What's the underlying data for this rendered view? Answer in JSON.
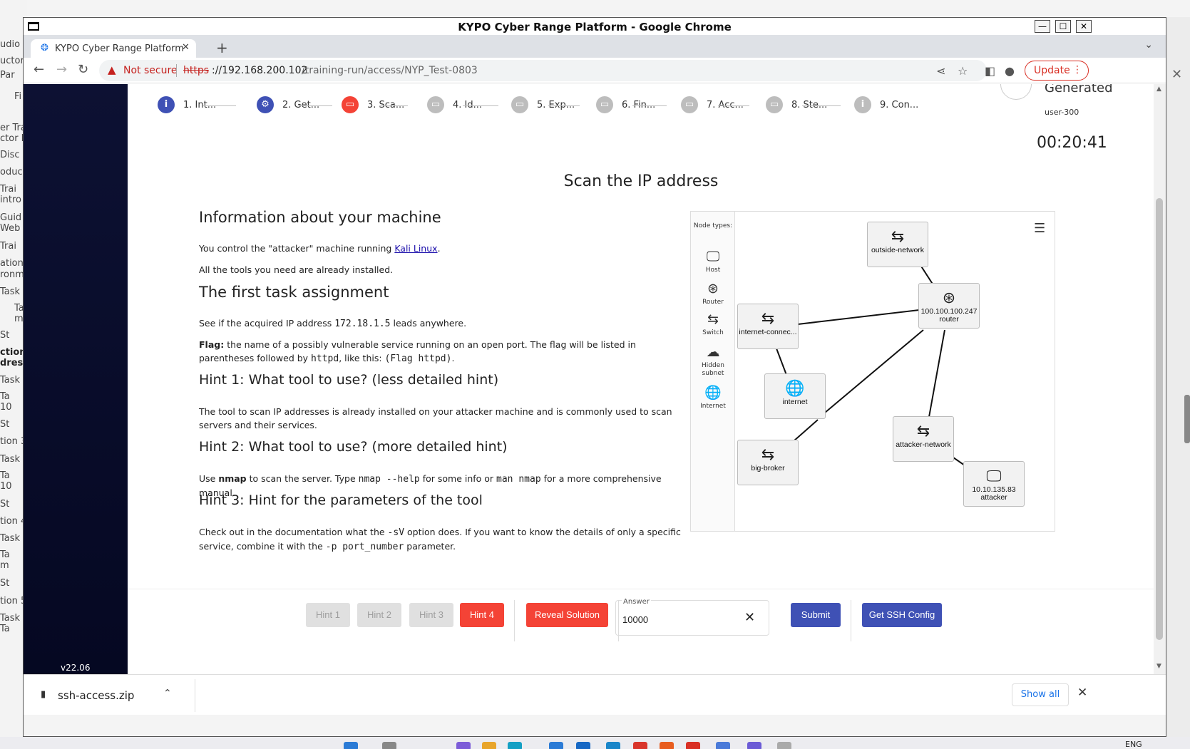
{
  "desktop": {
    "left_fragments": [
      "udio",
      "uctor_",
      "Par",
      "Fi",
      "er Trai",
      "ctor N",
      "Disc",
      "oduc",
      "Trai",
      "intro",
      "Guid",
      "Web",
      "Trai",
      "ation",
      "ronm",
      "Task",
      "Ta",
      "m",
      "St",
      "ction",
      "dress",
      "Task",
      "Ta",
      "10",
      "St",
      "tion 3",
      "Task",
      "Ta",
      "10",
      "St",
      "tion 4",
      "Task",
      "Ta",
      "m",
      "St",
      "tion 5",
      "Task",
      "Ta"
    ]
  },
  "window": {
    "title": "KYPO Cyber Range Platform - Google Chrome",
    "tab_title": "KYPO Cyber Range Platform",
    "tab_close": "✕",
    "new_tab": "+",
    "minimize": "—",
    "maximize": "☐",
    "close": "✕"
  },
  "toolbar": {
    "security": "Not secure",
    "url_scheme": "https",
    "url_host": "://192.168.200.102",
    "url_path": "/training-run/access/NYP_Test-0803",
    "update_label": "Update"
  },
  "sidebar": {
    "version": "v22.06"
  },
  "stepper": {
    "steps": [
      {
        "label": "1. Int...",
        "icon": "info-icon",
        "color": "#3f51b5"
      },
      {
        "label": "2. Get...",
        "icon": "gear-icon",
        "color": "#3f51b5"
      },
      {
        "label": "3. Sca...",
        "icon": "gamepad-icon",
        "color": "#f44336"
      },
      {
        "label": "4. Id...",
        "icon": "gamepad-icon",
        "color": "#bdbdbd"
      },
      {
        "label": "5. Exp...",
        "icon": "gamepad-icon",
        "color": "#bdbdbd"
      },
      {
        "label": "6. Fin...",
        "icon": "gamepad-icon",
        "color": "#bdbdbd"
      },
      {
        "label": "7. Acc...",
        "icon": "gamepad-icon",
        "color": "#bdbdbd"
      },
      {
        "label": "8. Ste...",
        "icon": "gamepad-icon",
        "color": "#bdbdbd"
      },
      {
        "label": "9. Con...",
        "icon": "info-icon",
        "color": "#bdbdbd"
      }
    ],
    "generated_title": "Generated",
    "user": "user-300",
    "timer": "00:20:41"
  },
  "level": {
    "title": "Scan the IP address",
    "h_machine": "Information about your machine",
    "p_machine_pre": "You control the \"attacker\" machine running ",
    "p_machine_link": "Kali Linux",
    "p_machine_post": ".",
    "p_tools": "All the tools you need are already installed.",
    "h_task": "The first task assignment",
    "p_task_pre": "See if the acquired IP address ",
    "p_task_ip": "172.18.1.5",
    "p_task_post": " leads anywhere.",
    "flag_label": "Flag:",
    "flag_text": " the name of a possibly vulnerable service running on an open port. The flag will be listed in parentheses followed by ",
    "flag_code1": "httpd",
    "flag_mid": ", like this: ",
    "flag_code2": "(Flag httpd)",
    "flag_end": ".",
    "h_hint1": "Hint 1: What tool to use? (less detailed hint)",
    "p_hint1": "The tool to scan IP addresses is already installed on your attacker machine and is commonly used to scan servers and their services.",
    "h_hint2": "Hint 2: What tool to use? (more detailed hint)",
    "p_hint2_pre": "Use ",
    "p_hint2_b": "nmap",
    "p_hint2_mid1": " to scan the server. Type ",
    "p_hint2_c1": "nmap --help",
    "p_hint2_mid2": " for some info or ",
    "p_hint2_c2": "man nmap",
    "p_hint2_end": " for a more comprehensive manual.",
    "h_hint3": "Hint 3: Hint for the parameters of the tool",
    "p_hint3_pre": "Check out in the documentation what the ",
    "p_hint3_c1": "-sV",
    "p_hint3_mid": " option does. If you want to know the details of only a specific service, combine it with the ",
    "p_hint3_c2": "-p port_number",
    "p_hint3_end": " parameter."
  },
  "topology": {
    "legend_title": "Node types:",
    "legend": [
      {
        "label": "Host",
        "icon": "monitor-icon"
      },
      {
        "label": "Router",
        "icon": "router-icon"
      },
      {
        "label": "Switch",
        "icon": "switch-icon"
      },
      {
        "label": "Hidden subnet",
        "icon": "cloud-icon"
      },
      {
        "label": "Internet",
        "icon": "globe-icon"
      }
    ],
    "nodes": [
      {
        "id": "outside-network",
        "lines": [
          "outside-network"
        ],
        "icon": "switch-icon"
      },
      {
        "id": "router",
        "lines": [
          "100.100.100.247",
          "router"
        ],
        "icon": "router-icon"
      },
      {
        "id": "internet-connect",
        "lines": [
          "internet-connec..."
        ],
        "icon": "switch-icon"
      },
      {
        "id": "internet",
        "lines": [
          "internet"
        ],
        "icon": "globe-icon"
      },
      {
        "id": "big-broker",
        "lines": [
          "big-broker"
        ],
        "icon": "switch-icon"
      },
      {
        "id": "attacker-network",
        "lines": [
          "attacker-network"
        ],
        "icon": "switch-icon"
      },
      {
        "id": "attacker",
        "lines": [
          "10.10.135.83",
          "attacker"
        ],
        "icon": "monitor-icon"
      }
    ]
  },
  "actions": {
    "hint1": "Hint 1",
    "hint2": "Hint 2",
    "hint3": "Hint 3",
    "hint4": "Hint 4",
    "reveal": "Reveal Solution",
    "answer_label": "Answer",
    "answer_value": "10000",
    "submit": "Submit",
    "ssh": "Get SSH Config"
  },
  "downloads": {
    "file": "ssh-access.zip",
    "show_all": "Show all"
  },
  "system": {
    "lang": "ENG"
  }
}
